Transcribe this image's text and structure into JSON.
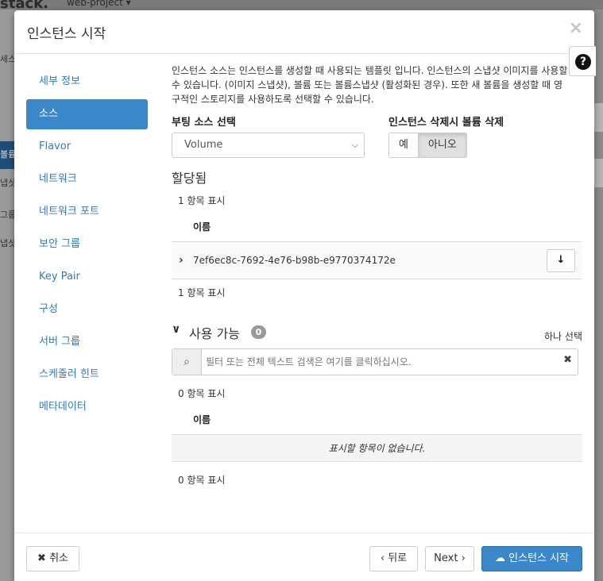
{
  "background": {
    "brand": "stack.",
    "project": "web-project ▾",
    "side_items": [
      "세스",
      "볼륨",
      "냅샷",
      "그룹",
      "냅샷"
    ]
  },
  "modal": {
    "title": "인스턴스 시작",
    "close_icon": "×",
    "help_icon": "?"
  },
  "nav": {
    "items": [
      {
        "label": "세부 정보",
        "active": false
      },
      {
        "label": "소스",
        "active": true
      },
      {
        "label": "Flavor",
        "active": false
      },
      {
        "label": "네트워크",
        "active": false
      },
      {
        "label": "네트워크 포트",
        "active": false
      },
      {
        "label": "보안 그룹",
        "active": false
      },
      {
        "label": "Key Pair",
        "active": false
      },
      {
        "label": "구성",
        "active": false
      },
      {
        "label": "서버 그룹",
        "active": false
      },
      {
        "label": "스케줄러 힌트",
        "active": false
      },
      {
        "label": "메타데이터",
        "active": false
      }
    ]
  },
  "source": {
    "description": "인스턴스 소스는 인스턴스를 생성할 때 사용되는 템플릿 입니다. 인스턴스의 스냅샷 이미지를 사용할 수 있습니다. (이미지 스냅샷), 볼륨 또는 볼륨스냅샷 (활성화된 경우). 또한 새 볼륨을 생성할 때 영구적인 스토리지를 사용하도록 선택할 수 있습니다.",
    "boot_source_label": "부팅 소스 선택",
    "boot_source_value": "Volume",
    "delete_volume_label": "인스턴스 삭제시 볼륨 삭제",
    "delete_yes": "예",
    "delete_no": "아니오",
    "delete_selected": "아니오"
  },
  "allocated": {
    "title": "할당됨",
    "count_top": "1 항목 표시",
    "col_name": "이름",
    "rows": [
      {
        "id": "7ef6ec8c-7692-4e76-b98b-e9770374172e"
      }
    ],
    "count_bottom": "1 항목 표시"
  },
  "available": {
    "title": "사용 가능",
    "badge": "0",
    "select_one": "하나 선택",
    "search_placeholder": "필터 또는 전체 텍스트 검색은 여기를 클릭하십시오.",
    "count_top": "0 항목 표시",
    "col_name": "이름",
    "empty_text": "표시할 항목이 없습니다.",
    "count_bottom": "0 항목 표시"
  },
  "footer": {
    "cancel": "취소",
    "back": "뒤로",
    "next": "Next",
    "launch": "인스턴스 시작"
  },
  "colors": {
    "primary": "#3a87c9",
    "link": "#337ab7"
  }
}
